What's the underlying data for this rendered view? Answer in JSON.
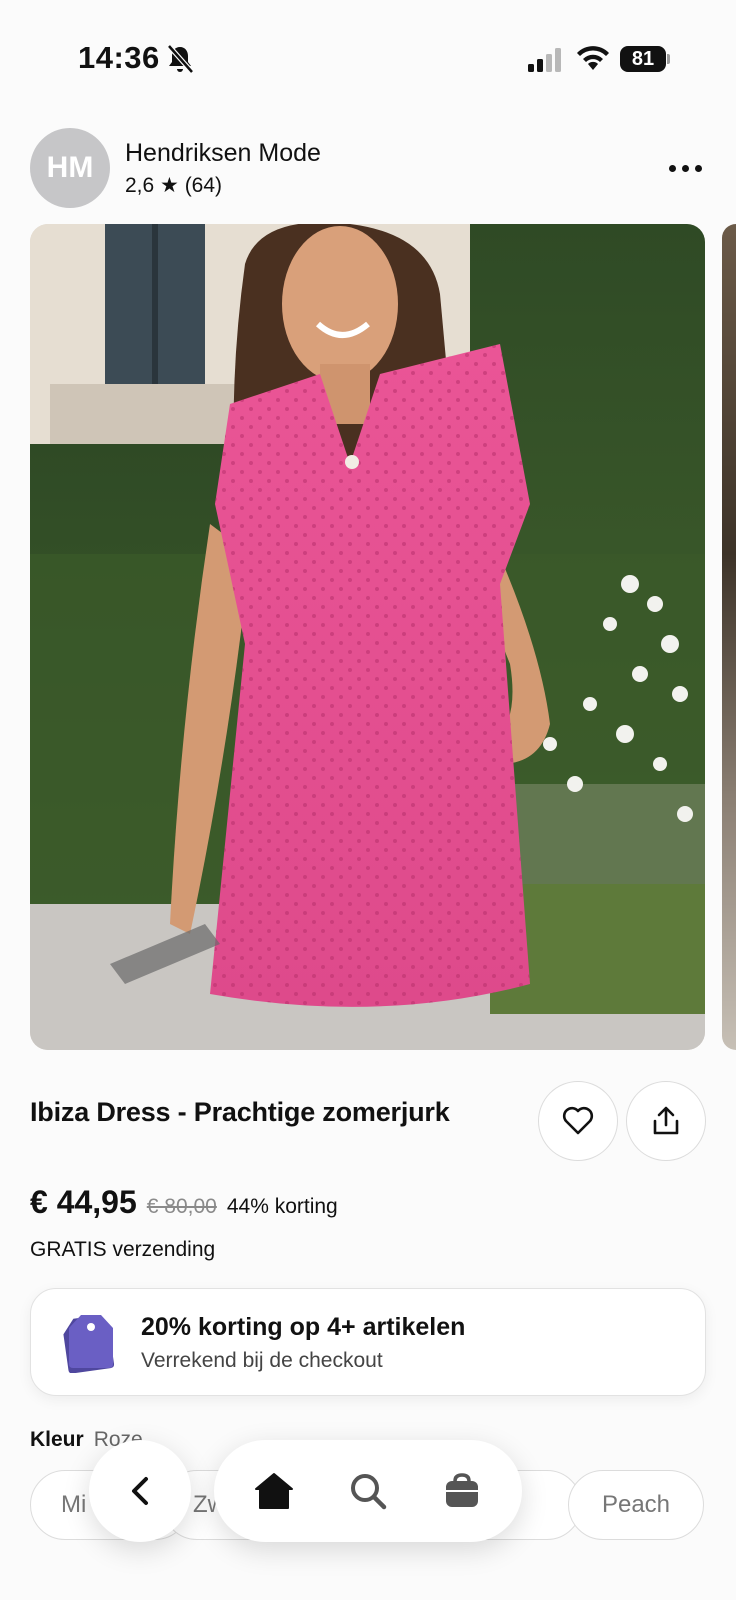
{
  "status_bar": {
    "time": "14:36",
    "battery": "81",
    "icons": [
      "bell-off-icon",
      "signal-icon",
      "wifi-icon",
      "battery-icon"
    ]
  },
  "seller": {
    "initials": "HM",
    "name": "Hendriksen Mode",
    "rating": "2,6 ★ (64)",
    "more_icon": "more-icon"
  },
  "product": {
    "title": "Ibiza Dress - Prachtige zomerjurk",
    "image_alt": "Model in roze zomerjurk",
    "price": "€ 44,95",
    "old_price": "€ 80,00",
    "discount": "44% korting",
    "shipping": "GRATIS verzending",
    "actions": {
      "like_icon": "heart-icon",
      "share_icon": "share-icon"
    }
  },
  "promo": {
    "title": "20% korting op 4+ artikelen",
    "subtitle": "Verrekend bij de checkout",
    "icon": "price-tag-icon"
  },
  "color": {
    "label": "Kleur",
    "selected": "Roze",
    "options": [
      "Mi",
      "Zw",
      ".",
      "Peach"
    ]
  },
  "nav": {
    "icons": [
      "back-icon",
      "home-icon",
      "search-icon",
      "cart-icon"
    ]
  },
  "colors": {
    "accent_pink": "#e64f92",
    "promo_tag": "#5a4fb0",
    "text": "#111111",
    "muted": "#8a8a8a"
  }
}
